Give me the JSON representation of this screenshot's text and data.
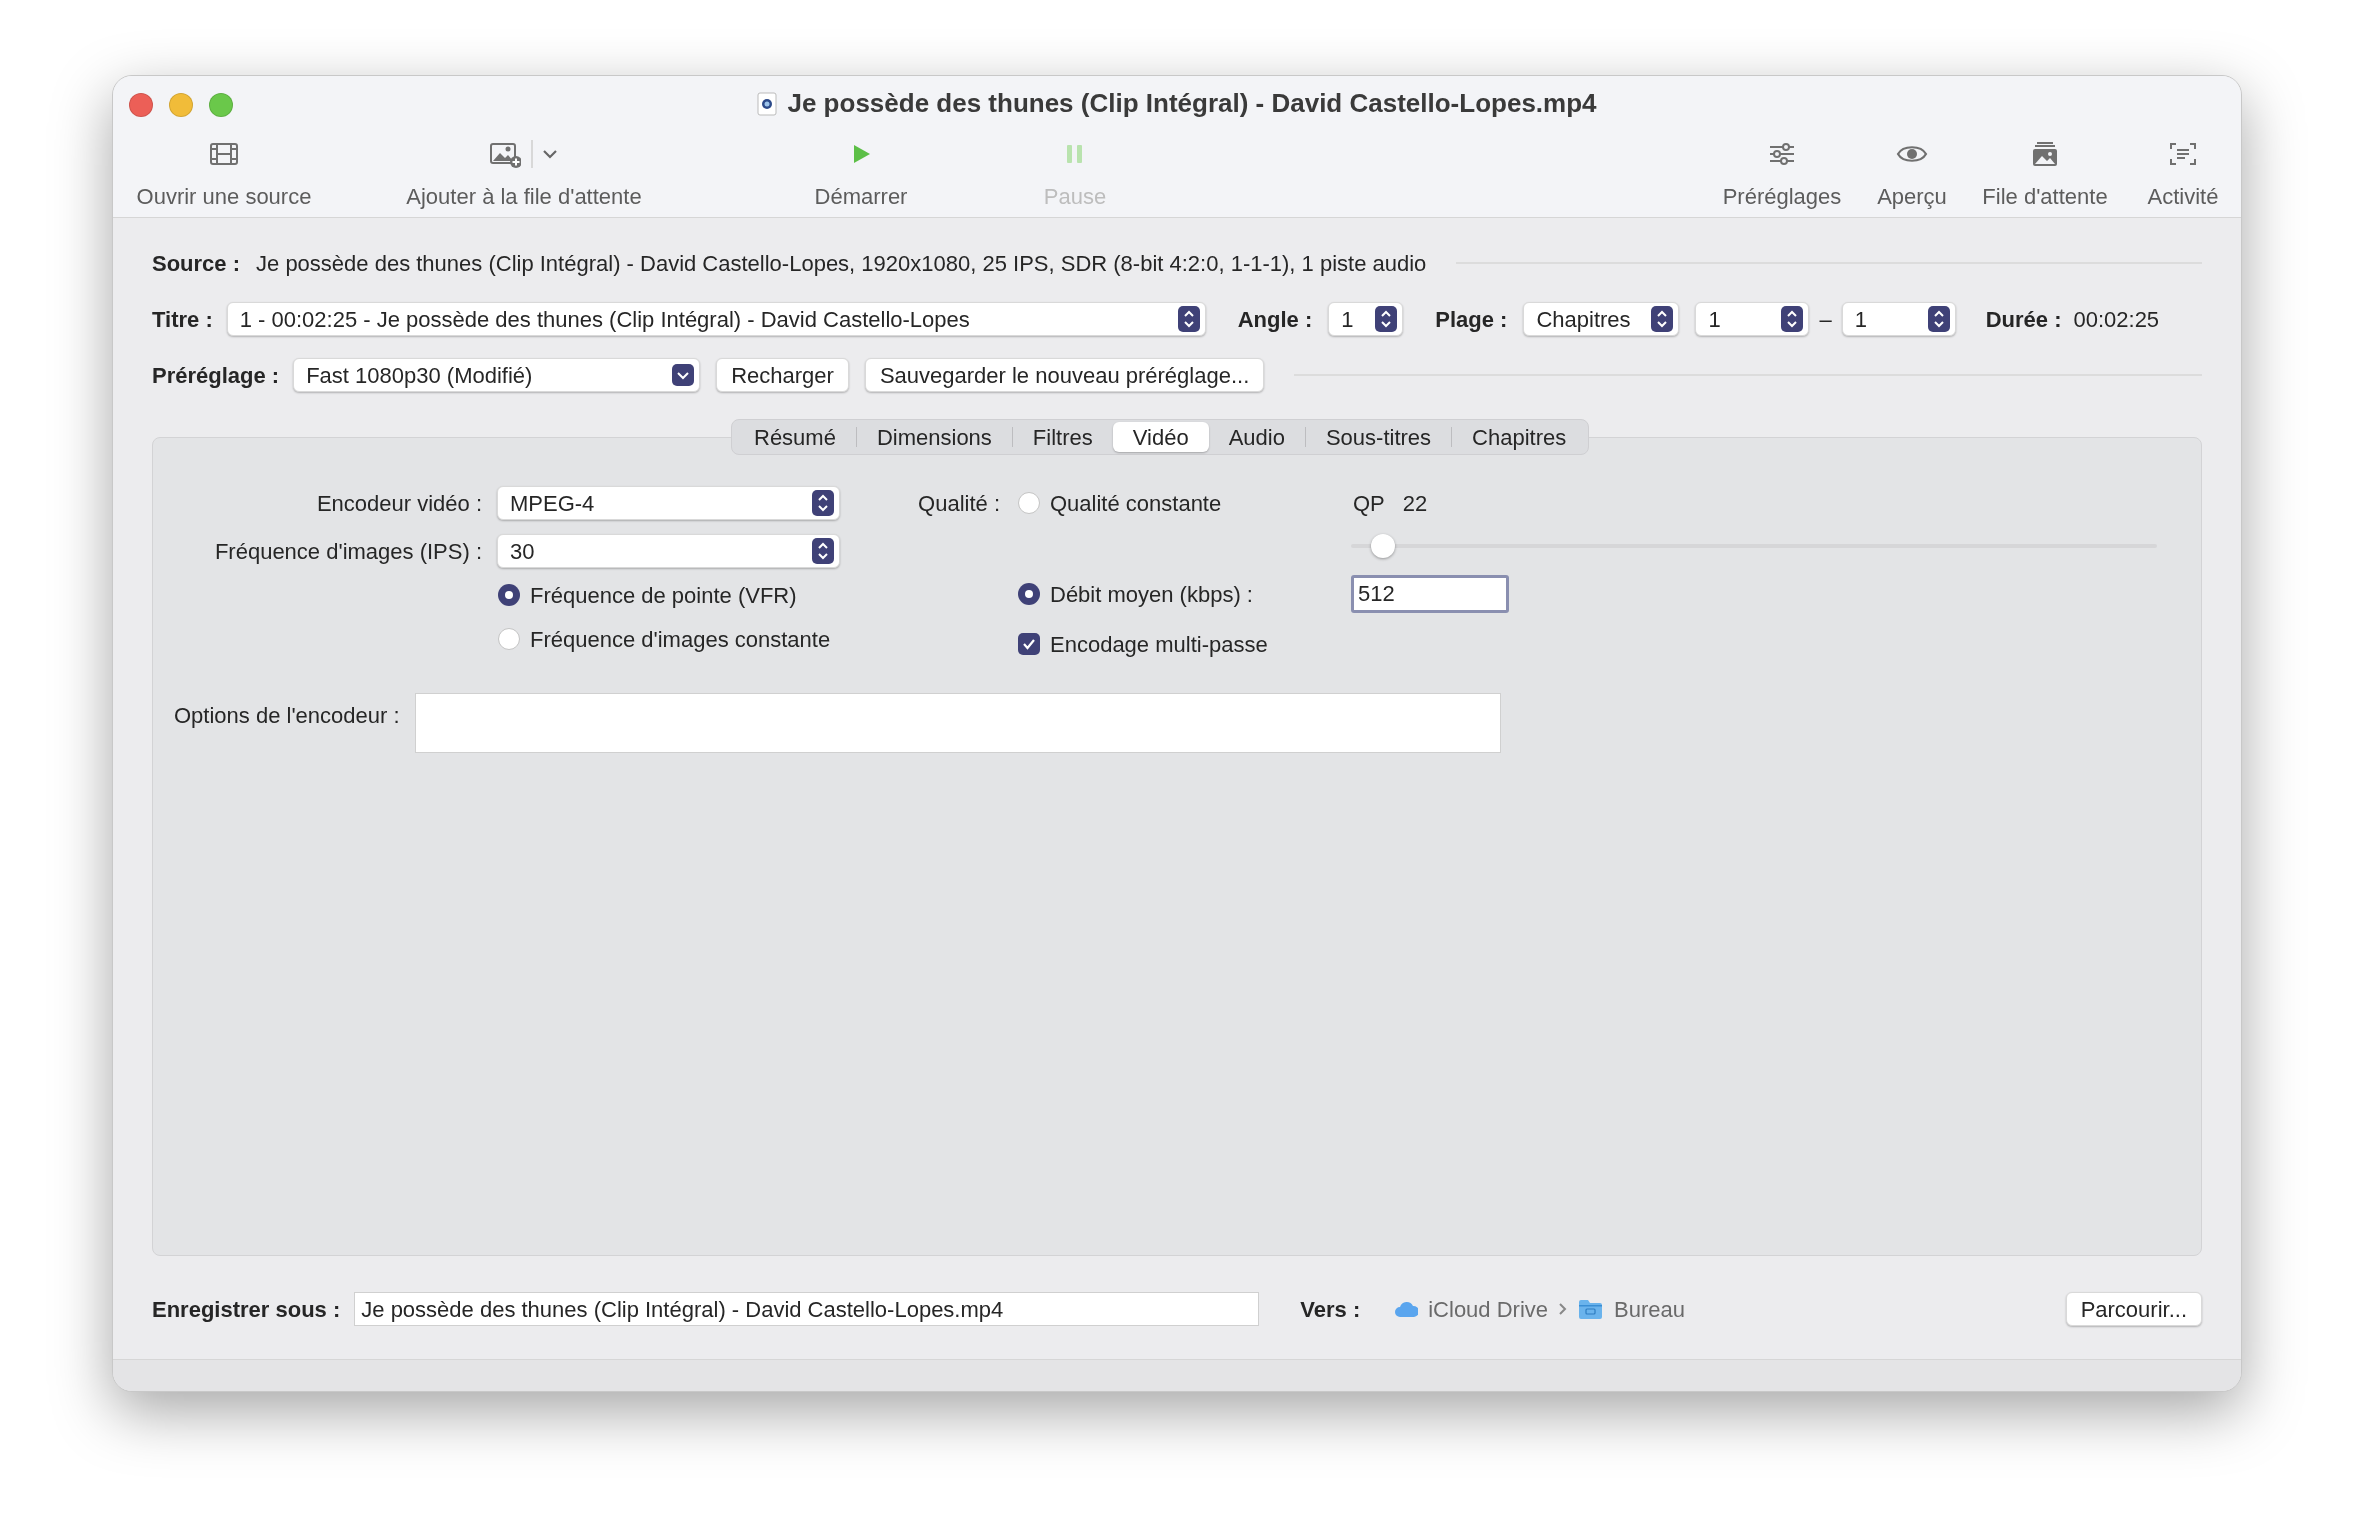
{
  "window": {
    "title": "Je possède des thunes (Clip Intégral) - David Castello-Lopes.mp4"
  },
  "toolbar": [
    {
      "label": "Ouvrir une source",
      "kind": "film",
      "disabled": false,
      "dropdown": false
    },
    {
      "label": "Ajouter à la file d'attente",
      "kind": "add-image",
      "disabled": false,
      "dropdown": true
    },
    {
      "label": "Démarrer",
      "kind": "play",
      "disabled": false,
      "dropdown": false
    },
    {
      "label": "Pause",
      "kind": "pause",
      "disabled": true,
      "dropdown": false
    },
    {
      "label": "Préréglages",
      "kind": "sliders",
      "disabled": false,
      "dropdown": false
    },
    {
      "label": "Aperçu",
      "kind": "eye",
      "disabled": false,
      "dropdown": false
    },
    {
      "label": "File d'attente",
      "kind": "queue",
      "disabled": false,
      "dropdown": false
    },
    {
      "label": "Activité",
      "kind": "activity",
      "disabled": false,
      "dropdown": false
    }
  ],
  "source": {
    "label": "Source :",
    "value": "Je possède des thunes (Clip Intégral) - David Castello-Lopes, 1920x1080, 25 IPS, SDR (8-bit 4:2:0, 1-1-1), 1 piste audio"
  },
  "title_row": {
    "label": "Titre :",
    "value": "1 - 00:02:25 - Je possède des thunes (Clip Intégral) - David Castello-Lopes",
    "angle_label": "Angle :",
    "angle": "1",
    "range_label": "Plage :",
    "range_kind": "Chapitres",
    "range_start": "1",
    "range_dash": "–",
    "range_end": "1",
    "duration_label": "Durée :",
    "duration": "00:02:25"
  },
  "preset": {
    "label": "Préréglage :",
    "value": "Fast 1080p30 (Modifié)",
    "buttons": [
      "Recharger",
      "Sauvegarder le nouveau préréglage..."
    ]
  },
  "tabs": [
    {
      "label": "Résumé",
      "selected": false
    },
    {
      "label": "Dimensions",
      "selected": false
    },
    {
      "label": "Filtres",
      "selected": false
    },
    {
      "label": "Vidéo",
      "selected": true
    },
    {
      "label": "Audio",
      "selected": false
    },
    {
      "label": "Sous-titres",
      "selected": false
    },
    {
      "label": "Chapitres",
      "selected": false
    }
  ],
  "video": {
    "encoder_label": "Encodeur vidéo :",
    "encoder": "MPEG-4",
    "framerate_label": "Fréquence d'images (IPS) :",
    "framerate": "30",
    "framerate_modes": [
      {
        "label": "Fréquence de pointe (VFR)",
        "selected": true
      },
      {
        "label": "Fréquence d'images constante",
        "selected": false
      }
    ],
    "quality_label": "Qualité :",
    "constant_quality": {
      "label": "Qualité constante",
      "selected": false
    },
    "qp_label": "QP",
    "qp_value": "22",
    "quality_slider": {
      "level": 0.04
    },
    "bitrate": {
      "label": "Débit moyen (kbps) :",
      "selected": true,
      "value": "512"
    },
    "multipass": {
      "label": "Encodage multi-passe",
      "checked": true
    },
    "options_label": "Options de l'encodeur :"
  },
  "save": {
    "label": "Enregistrer sous :",
    "value": "Je possède des thunes (Clip Intégral) - David Castello-Lopes.mp4",
    "to_label": "Vers :",
    "path": [
      "iCloud Drive",
      "Bureau"
    ],
    "browse": "Parcourir..."
  }
}
